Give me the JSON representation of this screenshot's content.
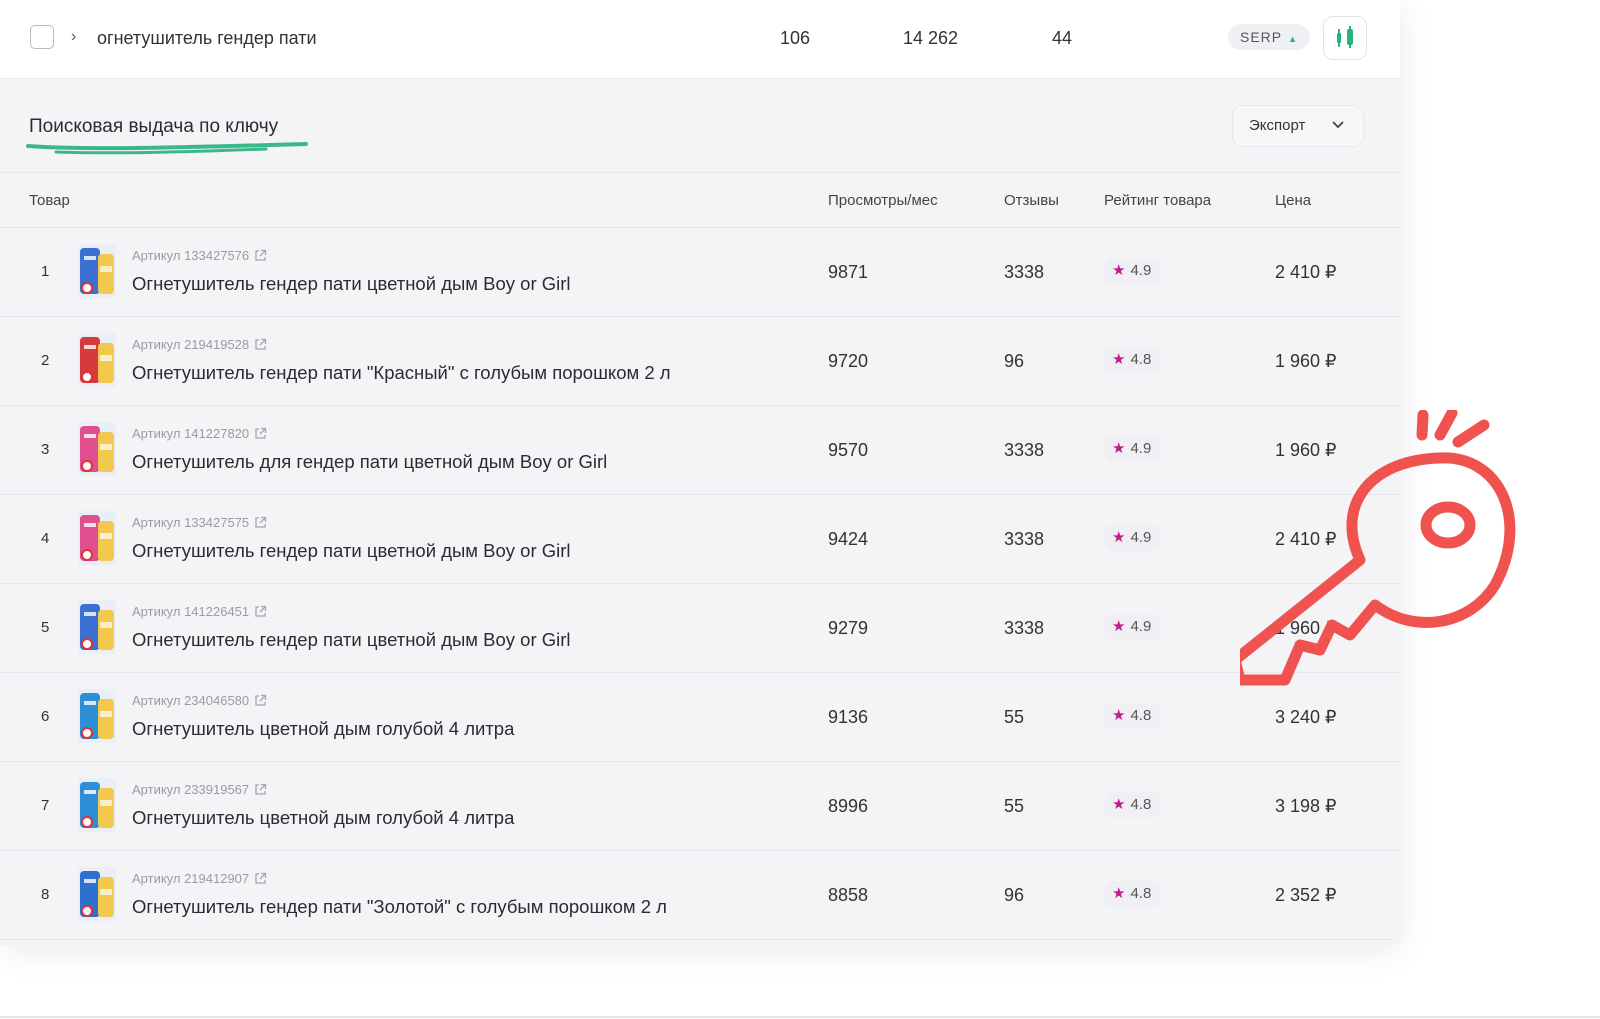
{
  "top_row": {
    "keyword": "огнетушитель гендер пати",
    "metric_1": "106",
    "metric_2": "14 262",
    "metric_3": "44",
    "serp_label": "SERP"
  },
  "section": {
    "title": "Поисковая выдача по ключу",
    "export_label": "Экспорт"
  },
  "table": {
    "headers": {
      "product": "Товар",
      "views": "Просмотры/мес",
      "reviews": "Отзывы",
      "rating": "Рейтинг товара",
      "price": "Цена"
    },
    "rows": [
      {
        "idx": "1",
        "sku": "Артикул 133427576",
        "name": "Огнетушитель гендер пати цветной дым Boy or Girl",
        "views": "9871",
        "reviews": "3338",
        "rating": "4.9",
        "price": "2 410 ₽",
        "thumb_color": "#3b6fd1"
      },
      {
        "idx": "2",
        "sku": "Артикул 219419528",
        "name": "Огнетушитель гендер пати \"Красный\" с голубым порошком 2 л",
        "views": "9720",
        "reviews": "96",
        "rating": "4.8",
        "price": "1 960 ₽",
        "thumb_color": "#d63a3a"
      },
      {
        "idx": "3",
        "sku": "Артикул 141227820",
        "name": "Огнетушитель для гендер пати цветной дым Boy or Girl",
        "views": "9570",
        "reviews": "3338",
        "rating": "4.9",
        "price": "1 960 ₽",
        "thumb_color": "#e0508e"
      },
      {
        "idx": "4",
        "sku": "Артикул 133427575",
        "name": "Огнетушитель гендер пати цветной дым Boy or Girl",
        "views": "9424",
        "reviews": "3338",
        "rating": "4.9",
        "price": "2 410 ₽",
        "thumb_color": "#e0508e"
      },
      {
        "idx": "5",
        "sku": "Артикул 141226451",
        "name": "Огнетушитель гендер пати цветной дым Boy or Girl",
        "views": "9279",
        "reviews": "3338",
        "rating": "4.9",
        "price": "1 960 ₽",
        "thumb_color": "#3b6fd1"
      },
      {
        "idx": "6",
        "sku": "Артикул 234046580",
        "name": "Огнетушитель цветной дым голубой 4 литра",
        "views": "9136",
        "reviews": "55",
        "rating": "4.8",
        "price": "3 240 ₽",
        "thumb_color": "#2e8fd6"
      },
      {
        "idx": "7",
        "sku": "Артикул 233919567",
        "name": "Огнетушитель цветной дым голубой 4 литра",
        "views": "8996",
        "reviews": "55",
        "rating": "4.8",
        "price": "3 198 ₽",
        "thumb_color": "#2e8fd6"
      },
      {
        "idx": "8",
        "sku": "Артикул 219412907",
        "name": "Огнетушитель гендер пати \"Золотой\" с голубым порошком 2 л",
        "views": "8858",
        "reviews": "96",
        "rating": "4.8",
        "price": "2 352 ₽",
        "thumb_color": "#2e6fd0"
      }
    ]
  },
  "colors": {
    "accent_green": "#27b37a",
    "star_magenta": "#c21a8e",
    "key_red": "#f0524f"
  },
  "icons": [
    "checkbox-icon",
    "chevron-right-icon",
    "serp-arrow-icon",
    "chart-icon",
    "chevron-down-icon",
    "external-link-icon",
    "star-icon",
    "key-illustration"
  ]
}
